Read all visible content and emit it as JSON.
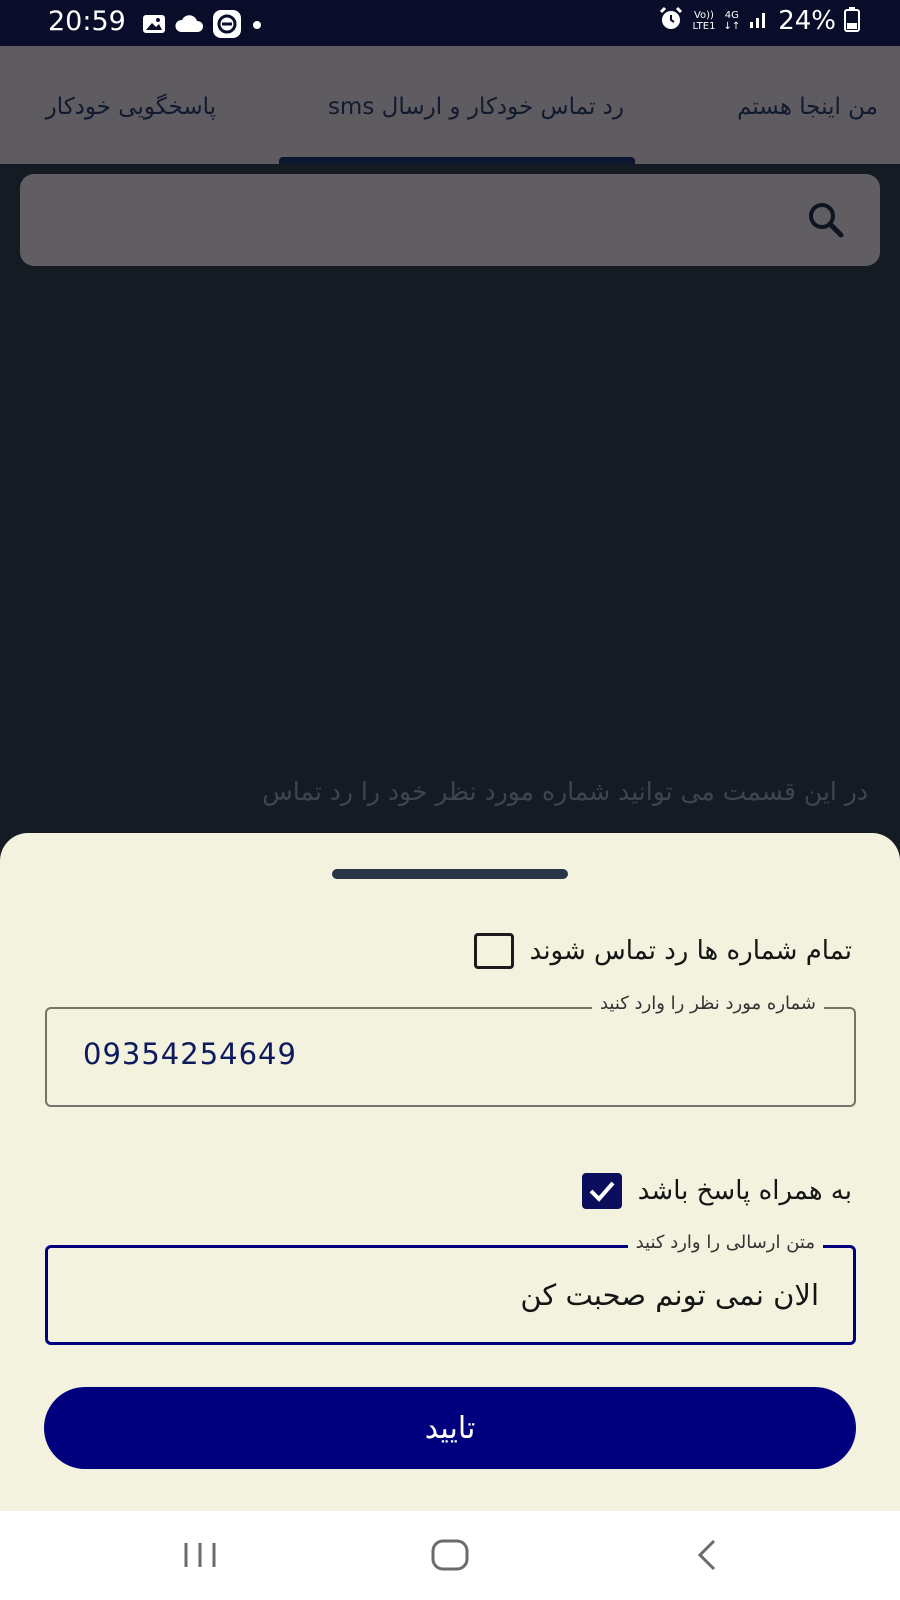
{
  "status_bar": {
    "time": "20:59",
    "left_icons": [
      "image-icon",
      "cloud-icon",
      "app-badge-icon",
      "dot-icon"
    ],
    "volte_label": "Vo))",
    "lte_label": "LTE1",
    "network_label": "4G",
    "battery_percent": "24%"
  },
  "tabs": [
    {
      "label": "من اینجا هستم",
      "selected": false
    },
    {
      "label": "رد تماس خودکار و ارسال sms",
      "selected": true
    },
    {
      "label": "پاسخگویی خودکار",
      "selected": false
    }
  ],
  "search": {
    "placeholder": ""
  },
  "background_text": "در این قسمت می توانید شماره مورد نظر خود را رد تماس",
  "sheet": {
    "reject_all_label": "تمام شماره ها رد تماس شوند",
    "reject_all_checked": false,
    "number_field": {
      "label": "شماره مورد نظر را وارد کنید",
      "value": "09354254649"
    },
    "with_reply_label": "به همراه پاسخ باشد",
    "with_reply_checked": true,
    "message_field": {
      "label": "متن ارسالی را  وارد کنید",
      "value": "الان نمی تونم صحبت کن"
    },
    "confirm_label": "تایید"
  },
  "colors": {
    "accent": "#00007e",
    "sheet_bg": "#f3f2de",
    "scrim_bg": "#151b22",
    "tab_bar_bg": "#5e5b61"
  }
}
